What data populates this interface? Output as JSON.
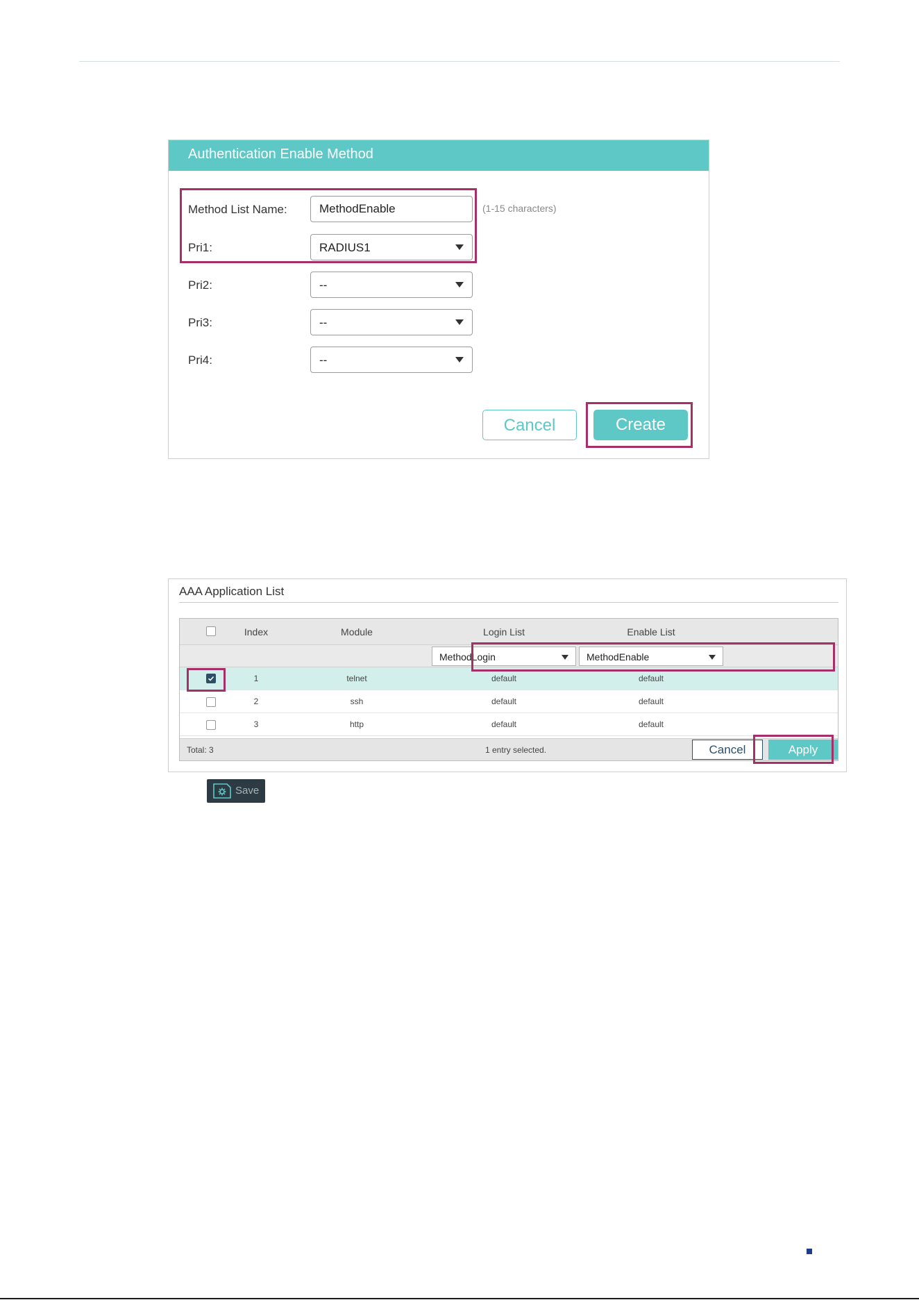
{
  "auth_form": {
    "title": "Authentication Enable Method",
    "method_list_name_label": "Method List Name:",
    "method_list_name_value": "MethodEnable",
    "method_list_name_hint": "(1-15 characters)",
    "priorities": [
      {
        "label": "Pri1:",
        "value": "RADIUS1"
      },
      {
        "label": "Pri2:",
        "value": "--"
      },
      {
        "label": "Pri3:",
        "value": "--"
      },
      {
        "label": "Pri4:",
        "value": "--"
      }
    ],
    "cancel_label": "Cancel",
    "create_label": "Create"
  },
  "app_list": {
    "title": "AAA Application List",
    "columns": [
      "Index",
      "Module",
      "Login List",
      "Enable List"
    ],
    "filter": {
      "login_list": "MethodLogin",
      "enable_list": "MethodEnable"
    },
    "rows": [
      {
        "checked": true,
        "index": "1",
        "module": "telnet",
        "login": "default",
        "enable": "default"
      },
      {
        "checked": false,
        "index": "2",
        "module": "ssh",
        "login": "default",
        "enable": "default"
      },
      {
        "checked": false,
        "index": "3",
        "module": "http",
        "login": "default",
        "enable": "default"
      }
    ],
    "total": "Total: 3",
    "selected_info": "1 entry selected.",
    "cancel_label": "Cancel",
    "apply_label": "Apply"
  },
  "save": {
    "label": "Save",
    "icon": "save-gear-icon"
  },
  "colors": {
    "accent": "#5ec8c6",
    "highlight": "#a72e66",
    "dark": "#2c4f63"
  }
}
